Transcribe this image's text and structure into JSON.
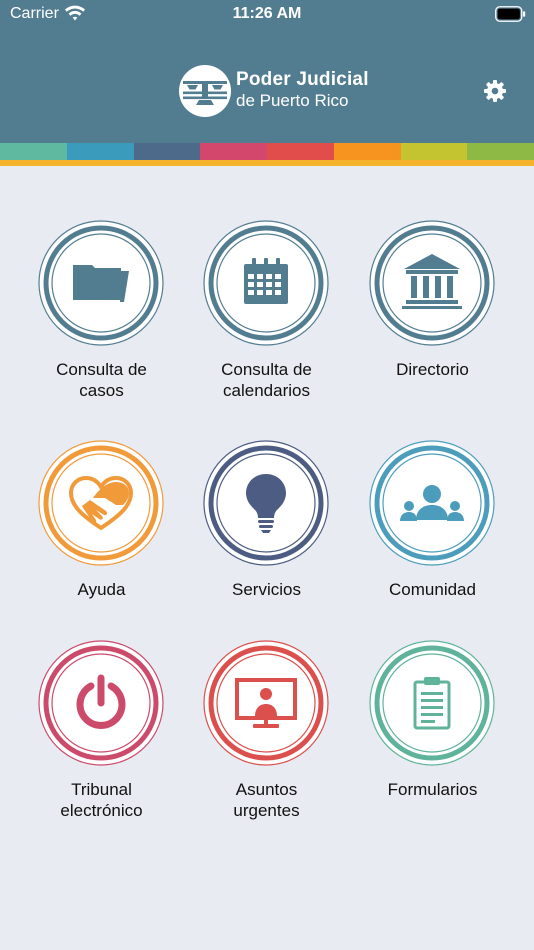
{
  "status_bar": {
    "carrier": "Carrier",
    "time": "11:26 AM"
  },
  "header": {
    "brand_line1": "Poder Judicial",
    "brand_line2": "de Puerto Rico",
    "settings_icon": "gear-icon"
  },
  "color_bar": [
    "#5fb8a0",
    "#3a9bbd",
    "#4d6a8a",
    "#d2476b",
    "#e14d4a",
    "#f6941f",
    "#c3c430",
    "#8eb944"
  ],
  "tiles": [
    {
      "label": "Consulta de\ncasos",
      "icon": "folder-icon",
      "color": "#527d91"
    },
    {
      "label": "Consulta de\ncalendarios",
      "icon": "calendar-icon",
      "color": "#527d91"
    },
    {
      "label": "Directorio",
      "icon": "courthouse-icon",
      "color": "#527d91"
    },
    {
      "label": "Ayuda",
      "icon": "handshake-heart-icon",
      "color": "#f09a3a"
    },
    {
      "label": "Servicios",
      "icon": "lightbulb-icon",
      "color": "#4c5c82"
    },
    {
      "label": "Comunidad",
      "icon": "community-icon",
      "color": "#4c9dbb"
    },
    {
      "label": "Tribunal\nelectrónico",
      "icon": "power-icon",
      "color": "#cc4a6a"
    },
    {
      "label": "Asuntos\nurgentes",
      "icon": "monitor-user-icon",
      "color": "#db4f4c"
    },
    {
      "label": "Formularios",
      "icon": "clipboard-icon",
      "color": "#5fb39a"
    }
  ]
}
